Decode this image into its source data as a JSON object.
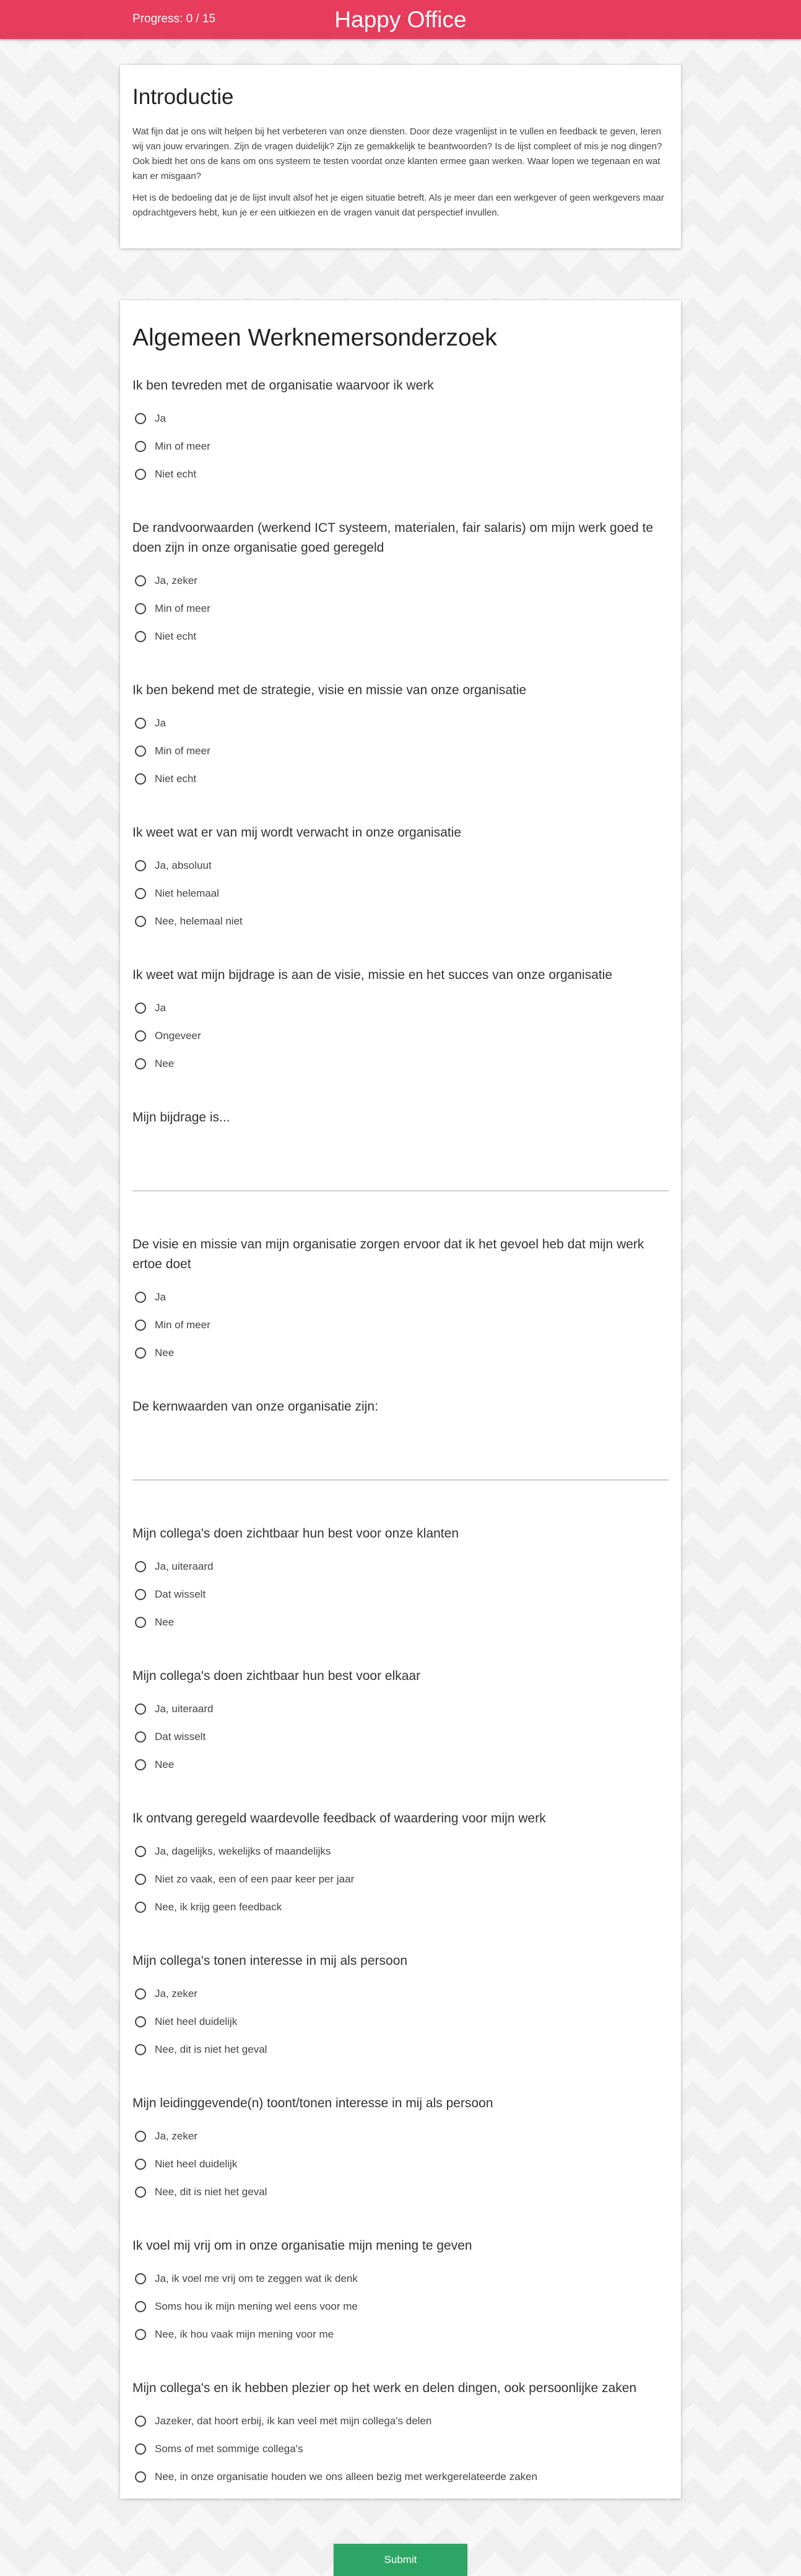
{
  "header": {
    "progress_text": "Progress: 0 / 15",
    "brand": "Happy Office",
    "accent_color": "#e73c5c"
  },
  "intro": {
    "title": "Introductie",
    "paragraph1": "Wat fijn dat je ons wilt helpen bij het verbeteren van onze diensten. Door deze vragenlijst in te vullen en feedback te geven, leren wij van jouw ervaringen. Zijn de vragen duidelijk? Zijn ze gemakkelijk te beantwoorden? Is de lijst compleet of mis je nog dingen? Ook biedt het ons de kans om ons systeem te testen voordat onze klanten ermee gaan werken. Waar lopen we tegenaan en wat kan er misgaan?",
    "paragraph2": "Het is de bedoeling dat je de lijst invult alsof het je eigen situatie betreft. Als je meer dan een werkgever of geen werkgevers maar opdrachtgevers hebt, kun je er een uitkiezen en de vragen vanuit dat perspectief invullen."
  },
  "survey": {
    "title": "Algemeen Werknemersonderzoek",
    "questions": [
      {
        "text": "Ik ben tevreden met de organisatie waarvoor ik werk",
        "options": [
          "Ja",
          "Min of meer",
          "Niet echt"
        ]
      },
      {
        "text": "De randvoorwaarden (werkend ICT systeem, materialen, fair salaris) om mijn werk goed te doen zijn in onze organisatie goed geregeld",
        "options": [
          "Ja, zeker",
          "Min of meer",
          "Niet echt"
        ]
      },
      {
        "text": "Ik ben bekend met de strategie, visie en missie van onze organisatie",
        "options": [
          "Ja",
          "Min of meer",
          "Niet echt"
        ]
      },
      {
        "text": "Ik weet wat er van mij wordt verwacht in onze organisatie",
        "options": [
          "Ja, absoluut",
          "Niet helemaal",
          "Nee, helemaal niet"
        ]
      },
      {
        "text": "Ik weet wat mijn bijdrage is aan de visie, missie en het succes van onze organisatie",
        "options": [
          "Ja",
          "Ongeveer",
          "Nee"
        ]
      },
      {
        "text": "Mijn bijdrage is...",
        "options": []
      },
      {
        "text": "De visie en missie van mijn organisatie zorgen ervoor dat ik het gevoel heb dat mijn werk ertoe doet",
        "options": [
          "Ja",
          "Min of meer",
          "Nee"
        ]
      },
      {
        "text": "De kernwaarden van onze organisatie zijn:",
        "options": []
      },
      {
        "text": "Mijn collega's doen zichtbaar hun best voor onze klanten",
        "options": [
          "Ja, uiteraard",
          "Dat wisselt",
          "Nee"
        ]
      },
      {
        "text": "Mijn collega's doen zichtbaar hun best voor elkaar",
        "options": [
          "Ja, uiteraard",
          "Dat wisselt",
          "Nee"
        ]
      },
      {
        "text": "Ik ontvang geregeld waardevolle feedback of waardering voor mijn werk",
        "options": [
          "Ja, dagelijks, wekelijks of maandelijks",
          "Niet zo vaak, een of een paar keer per jaar",
          "Nee, ik krijg geen feedback"
        ]
      },
      {
        "text": "Mijn collega's tonen interesse in mij als persoon",
        "options": [
          "Ja, zeker",
          "Niet heel duidelijk",
          "Nee, dit is niet het geval"
        ]
      },
      {
        "text": "Mijn leidinggevende(n) toont/tonen interesse in mij als persoon",
        "options": [
          "Ja, zeker",
          "Niet heel duidelijk",
          "Nee, dit is niet het geval"
        ]
      },
      {
        "text": "Ik voel mij vrij om in onze organisatie mijn mening te geven",
        "options": [
          "Ja, ik voel me vrij om te zeggen wat ik denk",
          "Soms hou ik mijn mening wel eens voor me",
          "Nee, ik hou vaak mijn mening voor me"
        ]
      },
      {
        "text": "Mijn collega's en ik hebben plezier op het werk en delen dingen, ook persoonlijke zaken",
        "options": [
          "Jazeker, dat hoort erbij, ik kan veel met mijn collega's delen",
          "Soms of met sommige collega's",
          "Nee, in onze organisatie houden we ons alleen bezig met werkgerelateerde zaken"
        ]
      }
    ],
    "submit_label": "Submit",
    "submit_color": "#2da564"
  }
}
